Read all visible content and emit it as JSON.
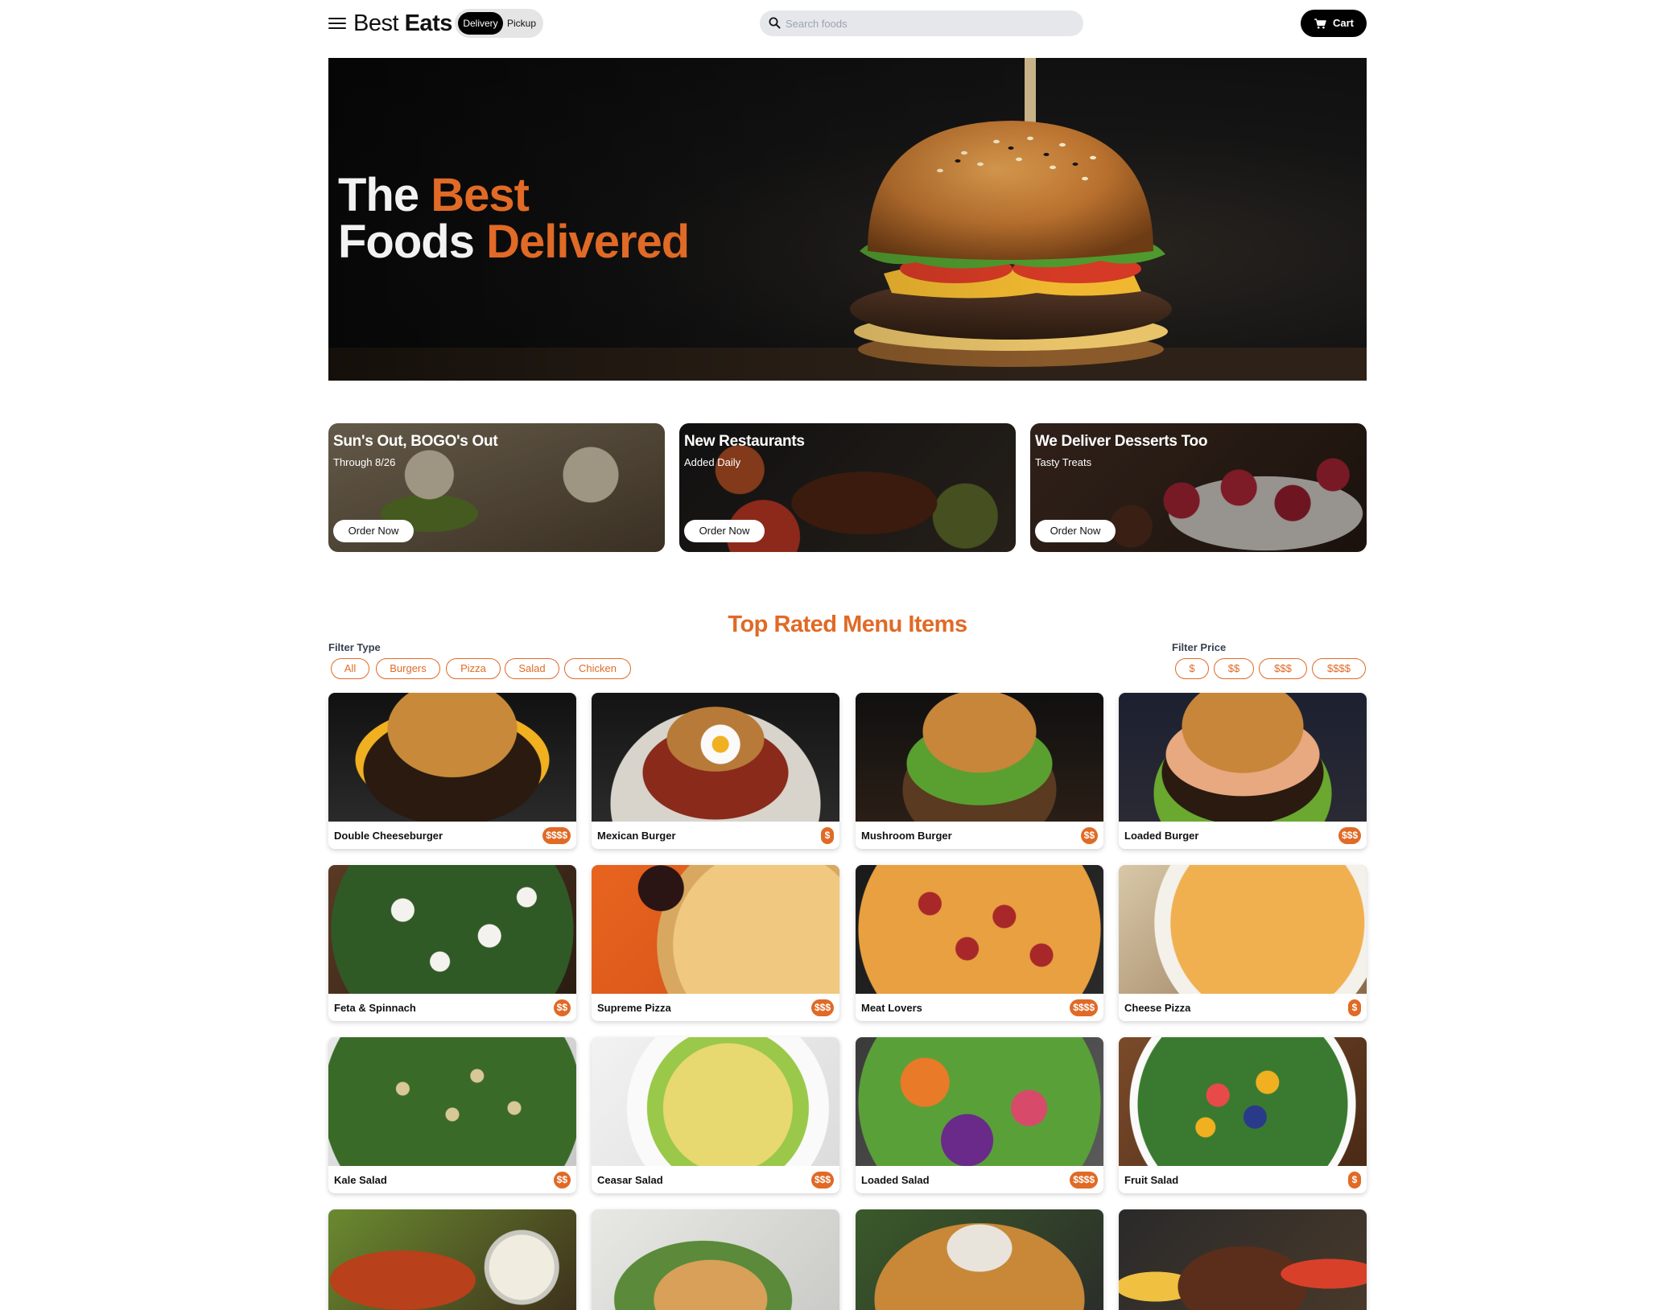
{
  "header": {
    "logo_light": "Best",
    "logo_bold": "Eats",
    "delivery_label": "Delivery",
    "pickup_label": "Pickup",
    "search_placeholder": "Search foods",
    "cart_label": "Cart"
  },
  "hero": {
    "line1_plain": "The ",
    "line1_accent": "Best",
    "line2_plain": "Foods ",
    "line2_accent": "Delivered"
  },
  "promos": [
    {
      "title": "Sun's Out, BOGO's Out",
      "subtitle": "Through 8/26",
      "button": "Order Now"
    },
    {
      "title": "New Restaurants",
      "subtitle": "Added Daily",
      "button": "Order Now"
    },
    {
      "title": "We Deliver Desserts Too",
      "subtitle": "Tasty Treats",
      "button": "Order Now"
    }
  ],
  "menu": {
    "title": "Top Rated Menu Items",
    "filter_type_label": "Filter Type",
    "filter_types": [
      "All",
      "Burgers",
      "Pizza",
      "Salad",
      "Chicken"
    ],
    "filter_price_label": "Filter Price",
    "filter_prices": [
      "$",
      "$$",
      "$$$",
      "$$$$"
    ],
    "items": [
      {
        "name": "Double Cheeseburger",
        "price": "$$$$"
      },
      {
        "name": "Mexican Burger",
        "price": "$"
      },
      {
        "name": "Mushroom Burger",
        "price": "$$"
      },
      {
        "name": "Loaded Burger",
        "price": "$$$"
      },
      {
        "name": "Feta & Spinnach",
        "price": "$$"
      },
      {
        "name": "Supreme Pizza",
        "price": "$$$"
      },
      {
        "name": "Meat Lovers",
        "price": "$$$$"
      },
      {
        "name": "Cheese Pizza",
        "price": "$"
      },
      {
        "name": "Kale Salad",
        "price": "$$"
      },
      {
        "name": "Ceasar Salad",
        "price": "$$$"
      },
      {
        "name": "Loaded Salad",
        "price": "$$$$"
      },
      {
        "name": "Fruit Salad",
        "price": "$"
      }
    ]
  },
  "colors": {
    "accent": "#e06a26",
    "dark": "#000000",
    "search_bg": "#e5e7eb"
  }
}
